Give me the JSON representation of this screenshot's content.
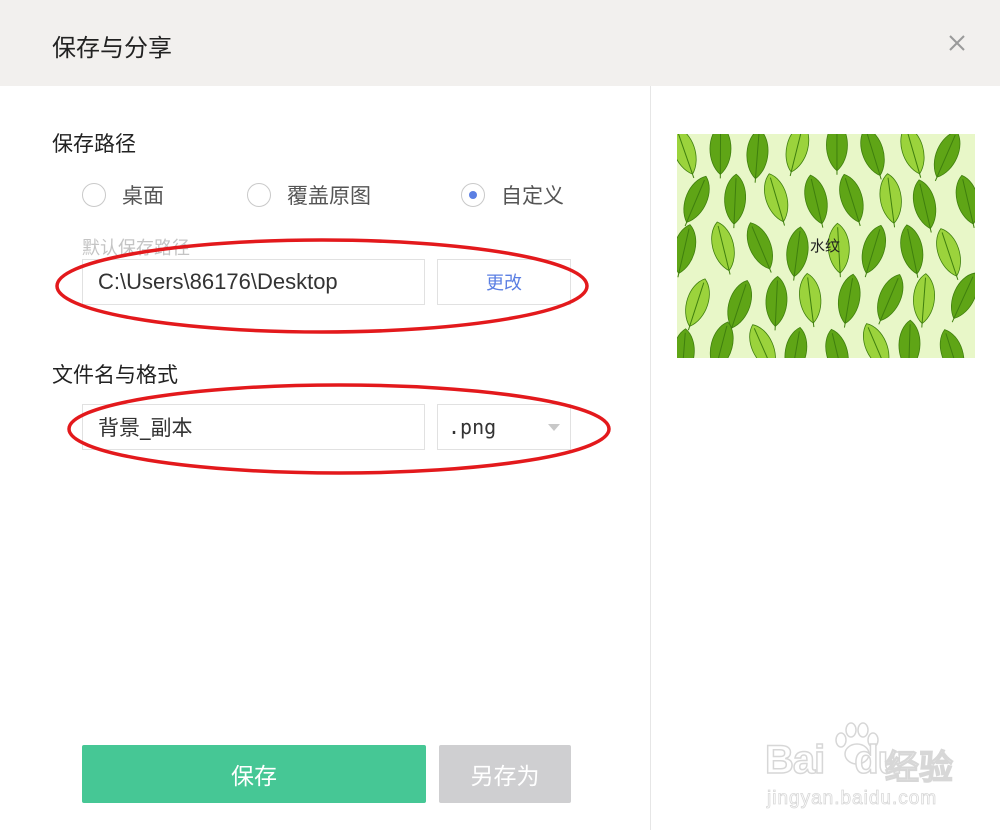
{
  "dialog": {
    "title": "保存与分享",
    "close_icon": "close-icon"
  },
  "save_path": {
    "label": "保存路径",
    "options": [
      {
        "label": "桌面",
        "checked": false
      },
      {
        "label": "覆盖原图",
        "checked": false
      },
      {
        "label": "自定义",
        "checked": true
      }
    ],
    "hint": "默认保存路径",
    "path_value": "C:\\Users\\86176\\Desktop",
    "change_label": "更改"
  },
  "file": {
    "label": "文件名与格式",
    "name_value": "背景_副本",
    "format_value": ".png",
    "format_icon": "chevron-down-icon"
  },
  "actions": {
    "save_label": "保存",
    "save_as_label": "另存为"
  },
  "preview": {
    "watermark_text": "水纹"
  },
  "baidu_watermark": {
    "logo": "Bai",
    "logo_suffix": "du",
    "cn": "经验",
    "url": "jingyan.baidu.com"
  },
  "colors": {
    "accent": "#5b7fe3",
    "primary_button": "#46c795",
    "disabled_button": "#cfcfd1",
    "annotation": "#e3191c",
    "leaf_light": "#9bd33c",
    "leaf_dark": "#5fa516"
  }
}
